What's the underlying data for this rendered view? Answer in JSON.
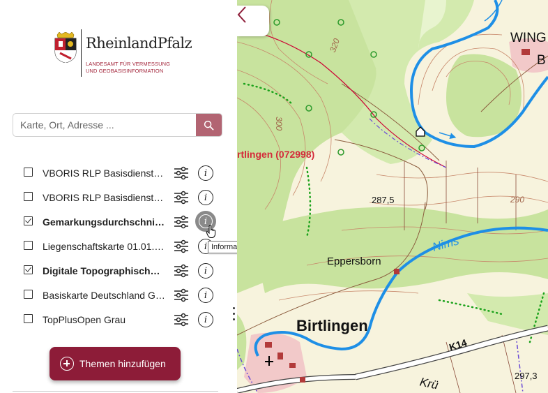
{
  "logo": {
    "brand": "RheinlandPfalz",
    "subtitle": "LANDESAMT FÜR VERMESSUNG\nUND GEOBASISINFORMATION"
  },
  "search": {
    "placeholder": "Karte, Ort, Adresse ..."
  },
  "layers": [
    {
      "label": "VBORIS RLP Basisdienst 2…",
      "checked": false,
      "bold": false
    },
    {
      "label": "VBORIS RLP Basisdienst 2…",
      "checked": false,
      "bold": false
    },
    {
      "label": "Gemarkungsdurchschnitt…",
      "checked": true,
      "bold": true
    },
    {
      "label": "Liegenschaftskarte 01.01.…",
      "checked": false,
      "bold": false
    },
    {
      "label": "Digitale Topographische …",
      "checked": true,
      "bold": true
    },
    {
      "label": "Basiskarte Deutschland G…",
      "checked": false,
      "bold": false
    },
    {
      "label": "TopPlusOpen Grau",
      "checked": false,
      "bold": false
    }
  ],
  "tooltip": "Informationen zum Datensatz anzeigen",
  "add_button": {
    "label": "Themen hinzufügen"
  },
  "map": {
    "labels": {
      "birtlingen_id": "rtlingen (072998)",
      "town": "Birtlingen",
      "eppersborn": "Eppersborn",
      "river": "Nims",
      "road": "K14",
      "wing": "WING",
      "b_top": "B",
      "b_right": "B",
      "kru": "Krü",
      "contour_320": "320",
      "contour_300": "300",
      "contour_290": "290",
      "spot_287": "287,5",
      "spot_297": "297,3"
    }
  },
  "colors": {
    "brand": "#8d1c38",
    "search_button": "#b26472",
    "river": "#1e8fe6",
    "forest": "#c8e39e",
    "contour": "#c7876a",
    "boundary": "#cc0033"
  }
}
